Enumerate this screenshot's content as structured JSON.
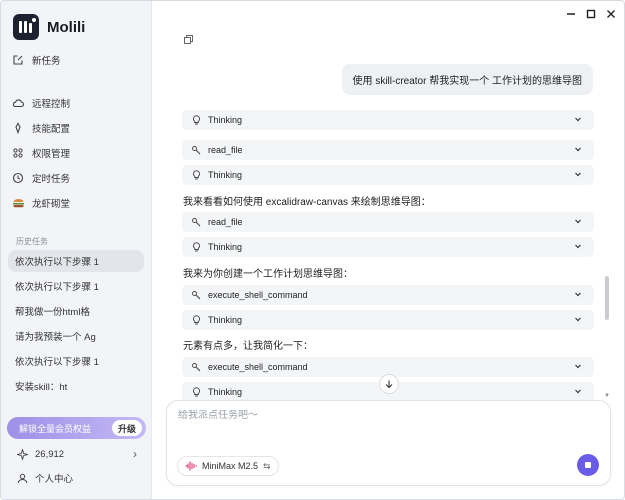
{
  "brand": {
    "name": "Molili"
  },
  "sidebar": {
    "new_task": "新任务",
    "items": [
      {
        "label": "远程控制",
        "icon": "cloud-icon"
      },
      {
        "label": "技能配置",
        "icon": "tag-icon"
      },
      {
        "label": "权限管理",
        "icon": "grid-icon"
      },
      {
        "label": "定时任务",
        "icon": "clock-icon"
      },
      {
        "label": "龙虾砌堂",
        "icon": "burger-icon"
      }
    ],
    "history_label": "历史任务",
    "history": [
      "依次执行以下步骤 1",
      "依次执行以下步骤 1",
      "帮我做一份html格",
      "请为我预装一个 Ag",
      "依次执行以下步骤 1",
      "安装skill：ht"
    ],
    "upgrade_text": "解锁全量会员权益",
    "upgrade_button": "升级",
    "credits": "26,912",
    "user_center": "个人中心"
  },
  "window": {
    "minimize": "—",
    "maximize": "□",
    "close": "✕"
  },
  "chat": {
    "user_message": "使用 skill-creator 帮我实现一个 工作计划的思维导图",
    "tool_rows": [
      "Thinking",
      "read_file",
      "Thinking",
      "read_file",
      "Thinking",
      "execute_shell_command",
      "Thinking",
      "execute_shell_command",
      "Thinking"
    ],
    "messages": [
      "我来看看如何使用 excalidraw-canvas 来绘制思维导图：",
      "我来为你创建一个工作计划思维导图：",
      "元素有点多，让我简化一下："
    ]
  },
  "composer": {
    "placeholder": "给我派点任务吧～",
    "model": "MiniMax M2.5",
    "accent": "#6b5ce7"
  }
}
